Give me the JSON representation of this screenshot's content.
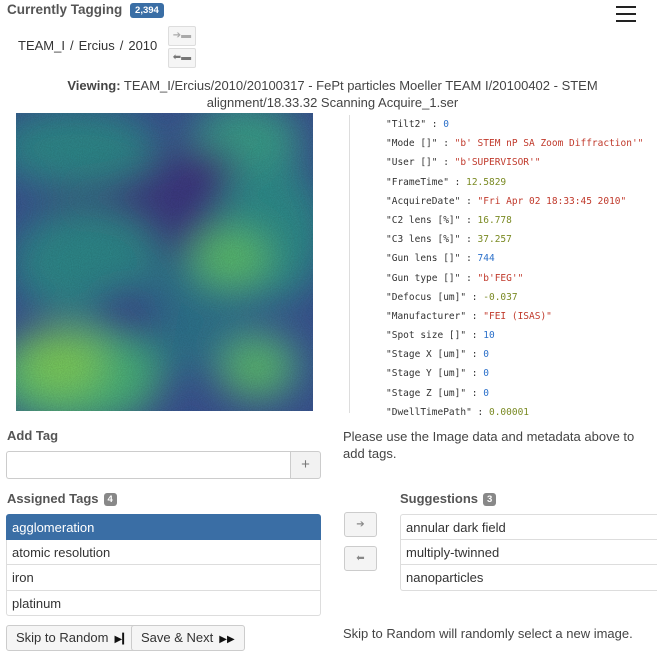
{
  "header": {
    "title": "Currently Tagging",
    "count_badge": "2,394"
  },
  "breadcrumb": [
    "TEAM_I",
    "Ercius",
    "2010"
  ],
  "viewing": {
    "label": "Viewing:",
    "path": "TEAM_I/Ercius/2010/20100317 - FePt particles Moeller TEAM I/20100402 - STEM alignment/18.33.32 Scanning Acquire_1.ser"
  },
  "metadata": [
    {
      "key": "\"Tilt2\"",
      "value": "0",
      "kind": "num"
    },
    {
      "key": "\"Mode []\"",
      "value": "\"b' STEM nP SA Zoom Diffraction'\"",
      "kind": "str"
    },
    {
      "key": "\"User []\"",
      "value": "\"b'SUPERVISOR'\"",
      "kind": "str"
    },
    {
      "key": "\"FrameTime\"",
      "value": "12.5829",
      "kind": "flt"
    },
    {
      "key": "\"AcquireDate\"",
      "value": "\"Fri Apr 02 18:33:45 2010\"",
      "kind": "str"
    },
    {
      "key": "\"C2 lens [%]\"",
      "value": "16.778",
      "kind": "flt"
    },
    {
      "key": "\"C3 lens [%]\"",
      "value": "37.257",
      "kind": "flt"
    },
    {
      "key": "\"Gun lens []\"",
      "value": "744",
      "kind": "num"
    },
    {
      "key": "\"Gun type []\"",
      "value": "\"b'FEG'\"",
      "kind": "str"
    },
    {
      "key": "\"Defocus [um]\"",
      "value": "-0.037",
      "kind": "flt"
    },
    {
      "key": "\"Manufacturer\"",
      "value": "\"FEI (ISAS)\"",
      "kind": "str"
    },
    {
      "key": "\"Spot size []\"",
      "value": "10",
      "kind": "num"
    },
    {
      "key": "\"Stage X [um]\"",
      "value": "0",
      "kind": "num"
    },
    {
      "key": "\"Stage Y [um]\"",
      "value": "0",
      "kind": "num"
    },
    {
      "key": "\"Stage Z [um]\"",
      "value": "0",
      "kind": "num"
    },
    {
      "key": "\"DwellTimePath\"",
      "value": "0.00001",
      "kind": "flt"
    }
  ],
  "add_tag": {
    "label": "Add Tag",
    "input_value": "",
    "add_icon": "plus-icon",
    "help_text": "Please use the Image data and metadata above to add tags."
  },
  "assigned": {
    "label": "Assigned Tags",
    "count": "4",
    "items": [
      "agglomeration",
      "atomic resolution",
      "iron",
      "platinum"
    ]
  },
  "suggestions": {
    "label": "Suggestions",
    "count": "3",
    "items": [
      "annular dark field",
      "multiply-twinned",
      "nanoparticles"
    ]
  },
  "actions": {
    "skip_label": "Skip to Random",
    "save_label": "Save & Next",
    "skip_note": "Skip to Random will randomly select a new image."
  },
  "colors": {
    "accent": "#3a6ea5",
    "selected_row": "#3a6ea5"
  }
}
